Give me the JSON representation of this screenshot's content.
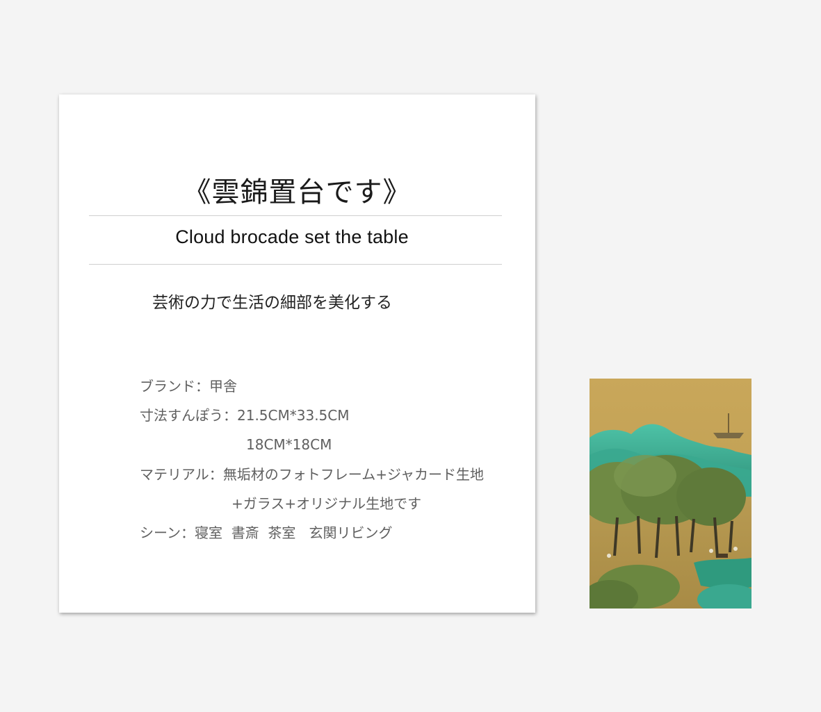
{
  "card": {
    "title_jp": "《雲錦置台です》",
    "title_en": "Cloud brocade set the table",
    "tagline": "芸術の力で生活の細部を美化する",
    "specs": {
      "brand_label": "ブランド：",
      "brand_value": "甲舎",
      "size_label": "寸法すんぽう：",
      "size_value_1": "21.5CM*33.5CM",
      "size_value_2": "18CM*18CM",
      "material_label": "マテリアル：",
      "material_value_1": "無垢材のフォトフレーム+ジャカード生地",
      "material_value_2": "+ガラス+オリジナル生地です",
      "scene_label": "シーン：",
      "scene_value": "寝室  書斎  茶室   玄関リビング"
    }
  },
  "colors": {
    "background": "#f4f4f4",
    "card": "#ffffff",
    "rule": "#cfcfcf",
    "spec_text": "#5f5f5f",
    "painting_sky": "#c9a75a",
    "painting_mountain": "#3fb59b",
    "painting_tree": "#5f7d3a"
  }
}
